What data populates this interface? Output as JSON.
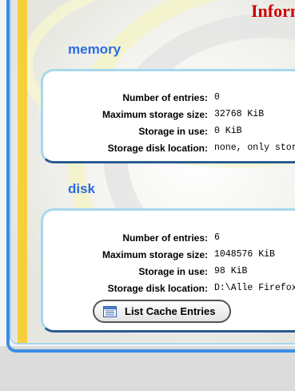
{
  "page": {
    "title": "Inform"
  },
  "memory": {
    "heading": "memory",
    "rows": [
      {
        "label": "Number of entries:",
        "value": "0"
      },
      {
        "label": "Maximum storage size:",
        "value": "32768 KiB"
      },
      {
        "label": "Storage in use:",
        "value": "0 KiB"
      },
      {
        "label": "Storage disk location:",
        "value": "none, only stor"
      }
    ]
  },
  "disk": {
    "heading": "disk",
    "rows": [
      {
        "label": "Number of entries:",
        "value": "6"
      },
      {
        "label": "Maximum storage size:",
        "value": "1048576 KiB"
      },
      {
        "label": "Storage in use:",
        "value": "98 KiB"
      },
      {
        "label": "Storage disk location:",
        "value": "D:\\Alle Firefox"
      }
    ],
    "list_button": {
      "label": "List Cache Entries",
      "icon": "list-icon"
    }
  },
  "colors": {
    "title": "#cc0000",
    "heading": "#2c6be0",
    "accent_blue": "#3a8ee6",
    "yellow_bar": "#f7cf3a",
    "box_border": "#a8d8ec"
  }
}
